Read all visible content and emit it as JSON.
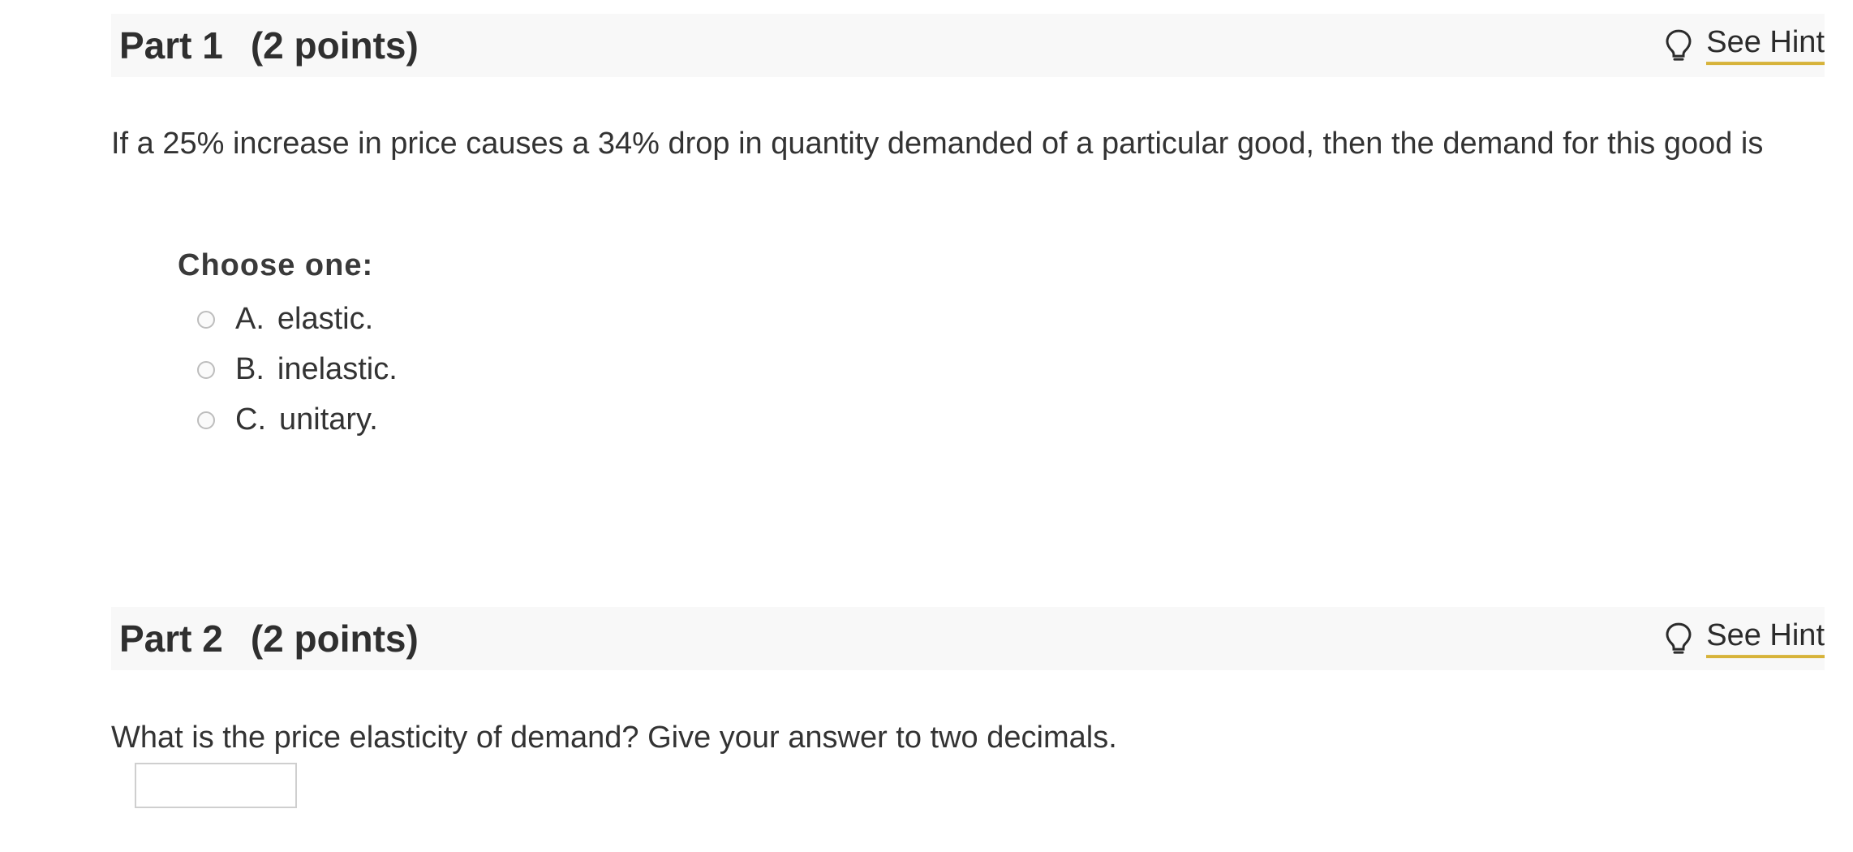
{
  "parts": [
    {
      "title": "Part 1",
      "points": "(2 points)",
      "hint_label": "See Hint",
      "question": "If a 25% increase in price causes a 34% drop in quantity demanded of a particular good, then the demand for this good is",
      "choose_label": "Choose one:",
      "options": [
        {
          "letter": "A.",
          "text": "elastic."
        },
        {
          "letter": "B.",
          "text": "inelastic."
        },
        {
          "letter": "C.",
          "text": "unitary."
        }
      ]
    },
    {
      "title": "Part 2",
      "points": "(2 points)",
      "hint_label": "See Hint",
      "question": "What is the price elasticity of demand? Give your answer to two decimals.",
      "answer_value": ""
    }
  ],
  "icons": {
    "hint": "lightbulb-icon"
  },
  "colors": {
    "header_bg": "#f8f8f8",
    "hint_underline": "#d7b33a",
    "text": "#333333"
  }
}
